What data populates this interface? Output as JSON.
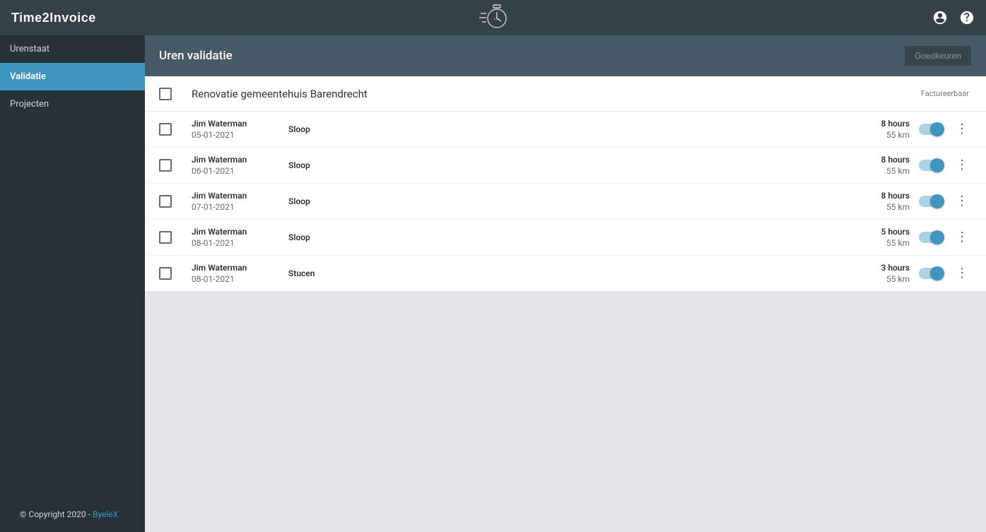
{
  "app": {
    "brand": "Time2Invoice",
    "logo_text": "Time2Invoice"
  },
  "sidebar": {
    "items": [
      {
        "label": "Urenstaat",
        "active": false
      },
      {
        "label": "Validatie",
        "active": true
      },
      {
        "label": "Projecten",
        "active": false
      }
    ]
  },
  "footer": {
    "copyright": "© Copyright 2020 - ",
    "link_text": "ByeleX"
  },
  "header": {
    "title": "Uren validatie",
    "approve_label": "Goedkeuren"
  },
  "project": {
    "title": "Renovatie gemeentehuis Barendrecht",
    "billable_label": "Factureerbaar"
  },
  "entries": [
    {
      "name": "Jim Waterman",
      "date": "05-01-2021",
      "task": "Sloop",
      "hours": "8 hours",
      "km": "55 km"
    },
    {
      "name": "Jim Waterman",
      "date": "06-01-2021",
      "task": "Sloop",
      "hours": "8 hours",
      "km": "55 km"
    },
    {
      "name": "Jim Waterman",
      "date": "07-01-2021",
      "task": "Sloop",
      "hours": "8 hours",
      "km": "55 km"
    },
    {
      "name": "Jim Waterman",
      "date": "08-01-2021",
      "task": "Sloop",
      "hours": "5 hours",
      "km": "55 km"
    },
    {
      "name": "Jim Waterman",
      "date": "08-01-2021",
      "task": "Stucen",
      "hours": "3 hours",
      "km": "55 km"
    }
  ]
}
